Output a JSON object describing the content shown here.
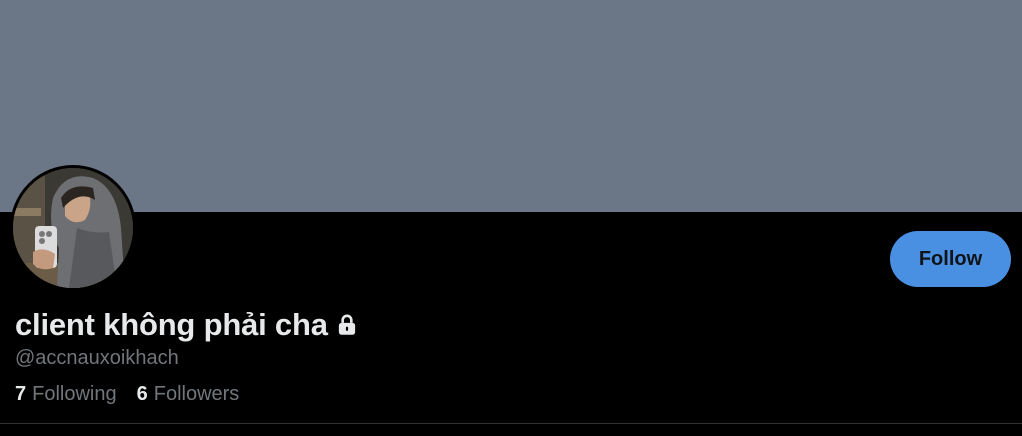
{
  "colors": {
    "banner": "#6b7786",
    "background": "#000000",
    "accent": "#4a90e2",
    "text_primary": "#e7e9ea",
    "text_secondary": "#71767b"
  },
  "profile": {
    "display_name": "client không phải cha",
    "handle": "@accnauxoikhach",
    "protected_icon": "lock-icon",
    "avatar_icon": "avatar-photo"
  },
  "actions": {
    "follow_label": "Follow"
  },
  "stats": [
    {
      "count": "7",
      "label": "Following"
    },
    {
      "count": "6",
      "label": "Followers"
    }
  ]
}
